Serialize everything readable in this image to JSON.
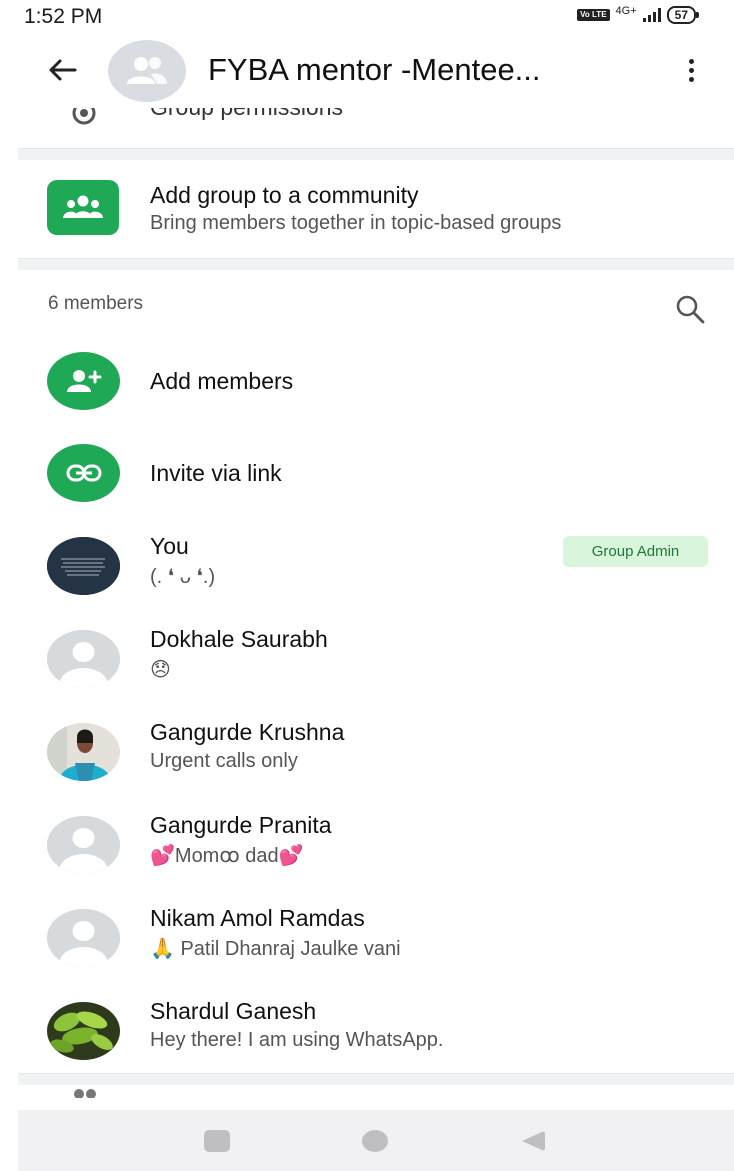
{
  "status_bar": {
    "time": "1:52 PM",
    "volte_badge": "Vo LTE",
    "network": "4G+",
    "battery": "57"
  },
  "header": {
    "title": "FYBA mentor -Mentee...",
    "back_icon": "arrow-left-icon",
    "menu_icon": "more-vertical-icon"
  },
  "settings": {
    "group_permissions_label": "Group permissions"
  },
  "community": {
    "title": "Add group to a community",
    "subtitle": "Bring members together in topic-based groups",
    "icon": "community-icon"
  },
  "members_section": {
    "count_label": "6 members",
    "search_icon": "search-icon",
    "add_members_label": "Add members",
    "invite_label": "Invite via link"
  },
  "members": [
    {
      "name": "You",
      "status": "(. ❛ ᴗ ❛.)",
      "badge": "Group Admin",
      "avatar": "dark-quote-avatar"
    },
    {
      "name": "Dokhale Saurabh",
      "status": "😞",
      "avatar": "default-avatar"
    },
    {
      "name": "Gangurde Krushna",
      "status": "Urgent calls only",
      "avatar": "photo-avatar-woman"
    },
    {
      "name": "Gangurde Pranita",
      "status": "💕Momꝏ dad💕",
      "avatar": "default-avatar"
    },
    {
      "name": "Nikam Amol Ramdas",
      "status": "🙏 Patil Dhanraj Jaulke vani",
      "avatar": "default-avatar"
    },
    {
      "name": "Shardul Ganesh",
      "status": "Hey there! I am using WhatsApp.",
      "avatar": "photo-avatar-plant"
    }
  ],
  "colors": {
    "accent_green": "#1fa855",
    "admin_badge_bg": "#d9f5dc",
    "admin_badge_text": "#1b7a3a"
  }
}
